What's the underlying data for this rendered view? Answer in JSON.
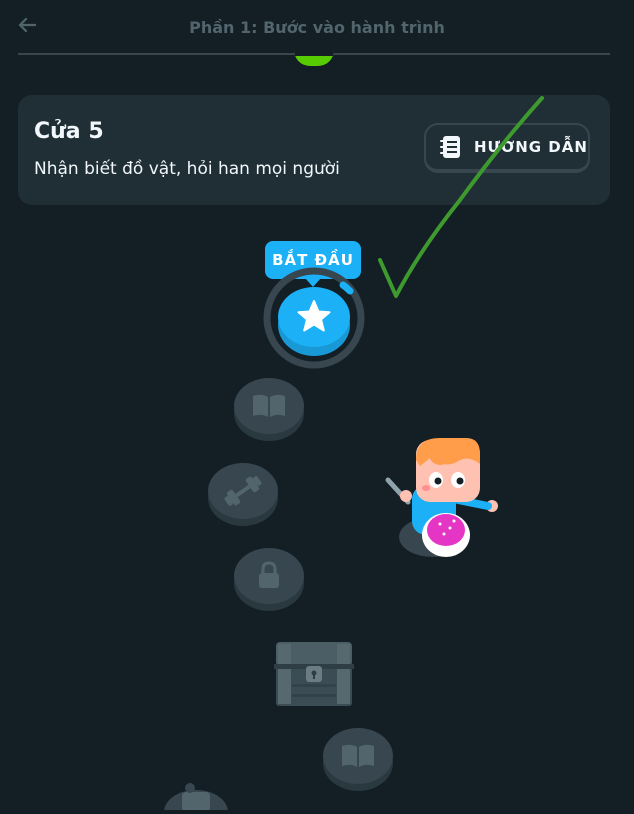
{
  "header": {
    "section_title": "Phần 1: Bước vào hành trình"
  },
  "unit": {
    "title": "Cửa 5",
    "subtitle": "Nhận biết đồ vật, hỏi han mọi người",
    "guide_label": "HƯỚNG DẪN"
  },
  "path": {
    "start_label": "BẮT ĐẦU"
  },
  "colors": {
    "background": "#131f24",
    "card": "#202f36",
    "accent_blue": "#1cb0f6",
    "completed_green": "#58cc02",
    "locked_node": "#37464f",
    "annotation_green": "#3e9a2e"
  },
  "icons": [
    "back-arrow-icon",
    "guidebook-icon",
    "star-icon",
    "book-icon",
    "dumbbell-icon",
    "lock-icon",
    "treasure-chest-icon",
    "trophy-icon"
  ]
}
